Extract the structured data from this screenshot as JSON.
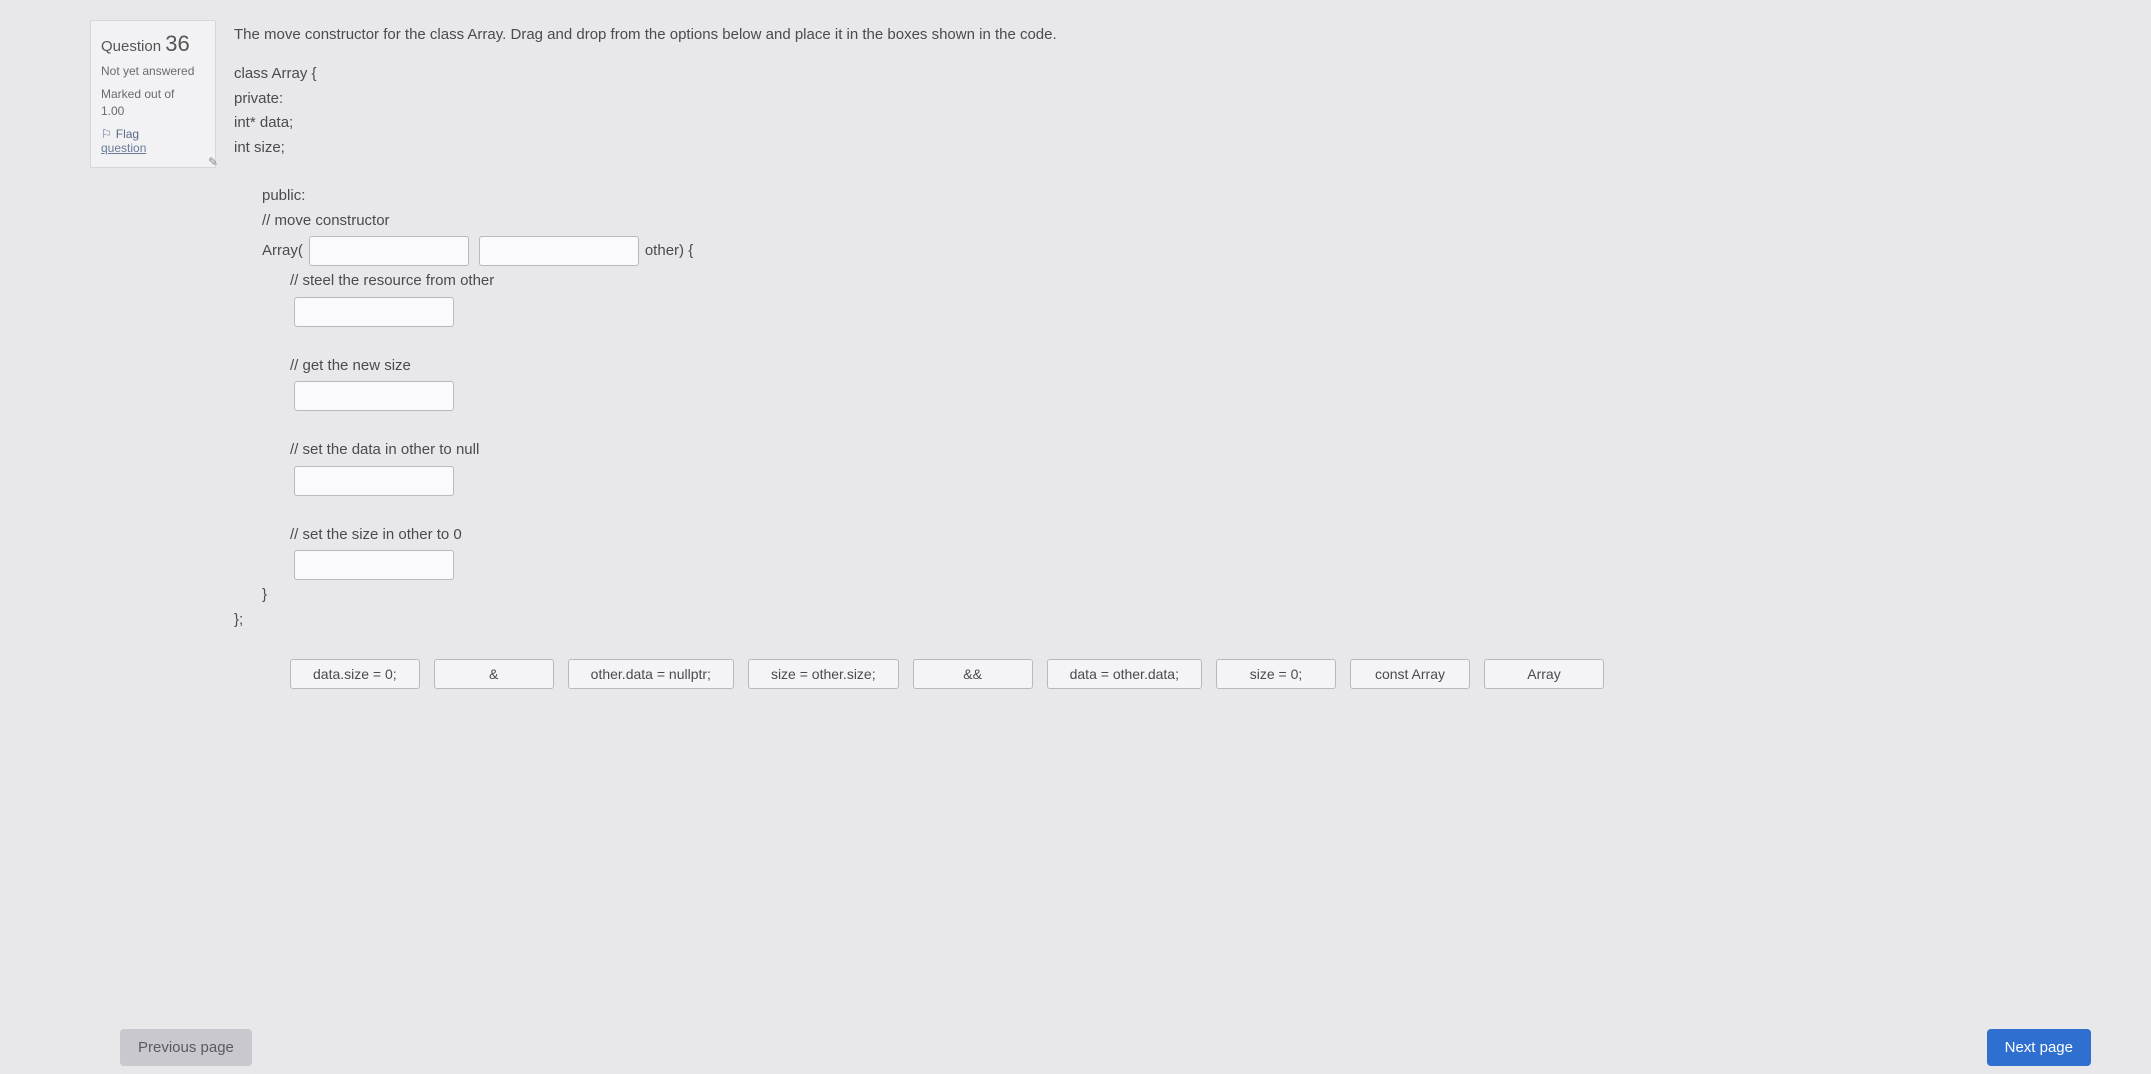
{
  "info": {
    "title_prefix": "Question",
    "number": "36",
    "status": "Not yet answered",
    "marked_label": "Marked out of",
    "marked_value": "1.00",
    "flag_label": "Flag",
    "flag_sub": "question"
  },
  "prompt": "The move constructor for the class Array.  Drag and drop from the options below and place it in the boxes shown in the code.",
  "code": {
    "l1": "class Array {",
    "l2": "private:",
    "l3": "int* data;",
    "l4": "int size;",
    "l5": "public:",
    "l6": "// move constructor",
    "l7a": "Array(",
    "l7b": "other) {",
    "c1": "// steel the resource from other",
    "c2": "// get the new size",
    "c3": "// set the data in other to null",
    "c4": "// set the size in other to 0",
    "l8": "}",
    "l9": "};"
  },
  "options": [
    "data.size = 0;",
    "&",
    "other.data = nullptr;",
    "size = other.size;",
    "&&",
    "data = other.data;",
    "size = 0;",
    "const Array",
    "Array"
  ],
  "nav": {
    "prev": "Previous page",
    "next": "Next page"
  }
}
